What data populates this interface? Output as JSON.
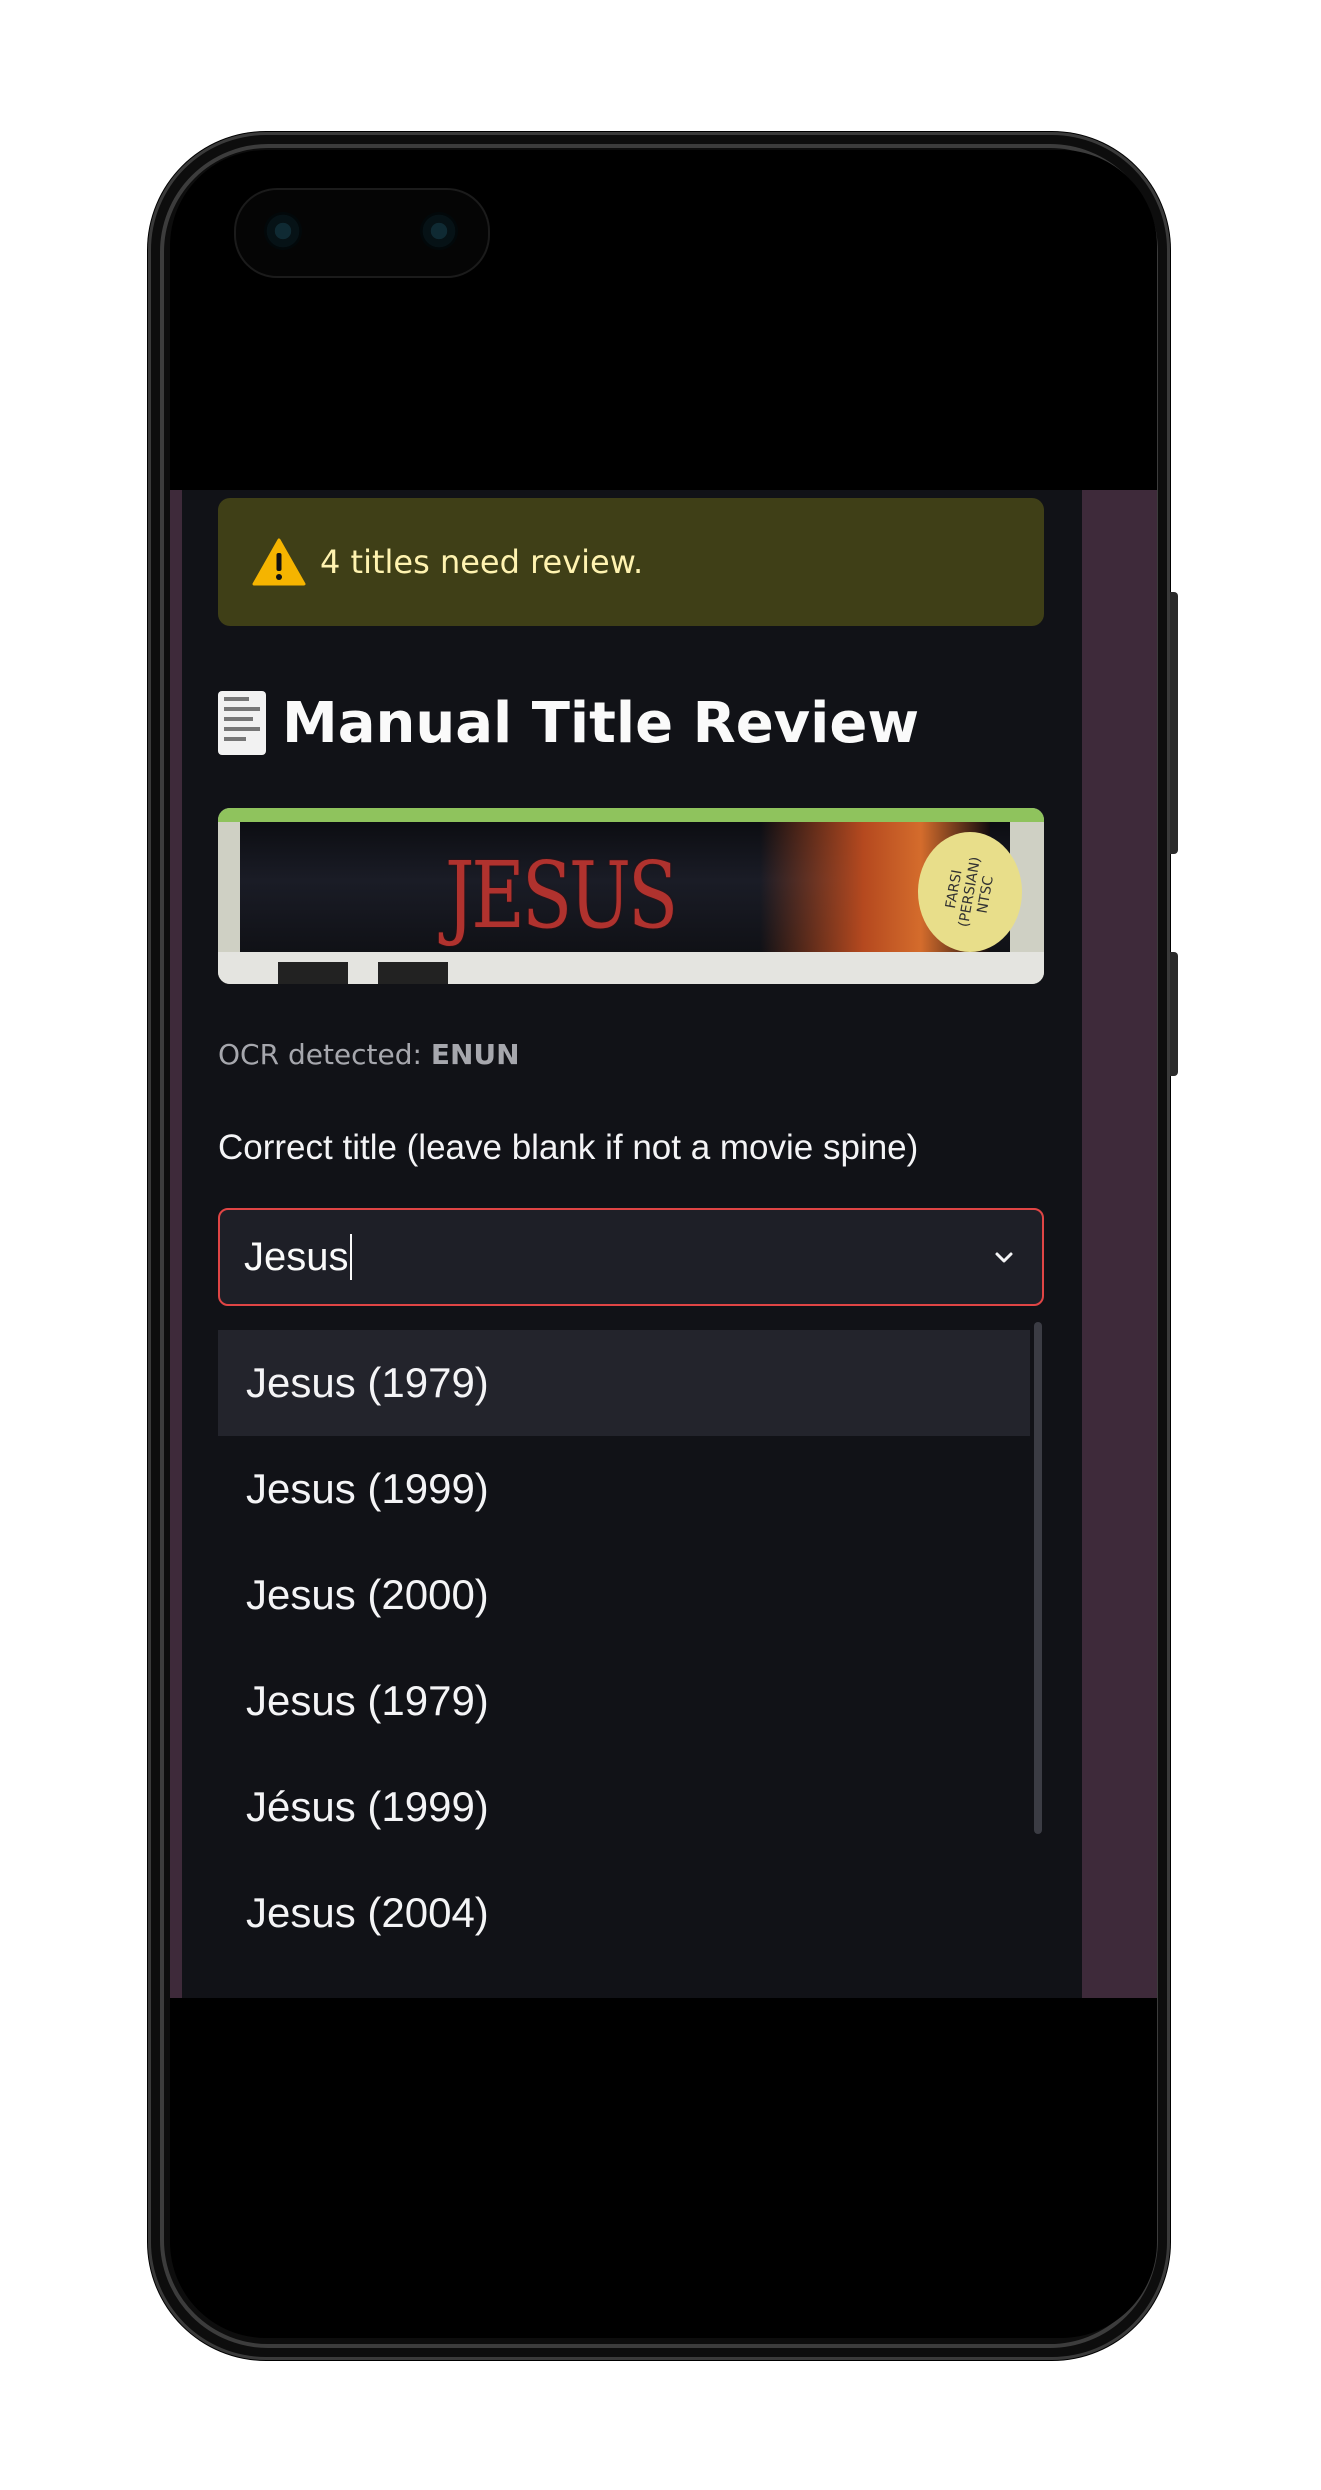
{
  "warning": {
    "text": "4 titles need review.",
    "icon": "warning-icon",
    "color": "#3f3f17"
  },
  "review": {
    "heading": "Manual Title Review",
    "heading_icon": "receipt-icon",
    "image": {
      "spine_text": "JESUS",
      "sticker_text": "FARSI (PERSIAN) NTSC"
    },
    "ocr_label": "OCR detected:",
    "ocr_value": "ENUN",
    "field_label": "Correct title (leave blank if not a movie spine)",
    "input_value": "Jesus",
    "options": [
      "Jesus (1979)",
      "Jesus (1999)",
      "Jesus (2000)",
      "Jesus (1979)",
      "Jésus (1999)",
      "Jesus (2004)"
    ]
  },
  "colors": {
    "panel": "#111217",
    "sidebar": "#3e2a3a",
    "invalid_border": "#e04545"
  }
}
